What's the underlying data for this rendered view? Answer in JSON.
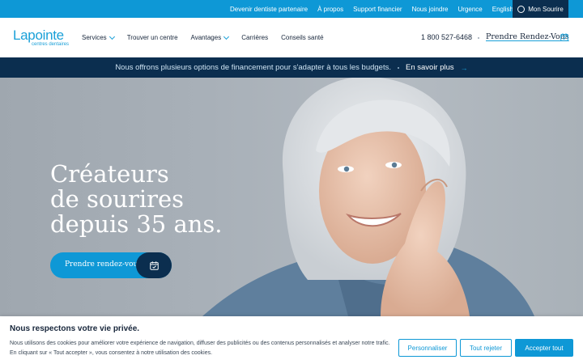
{
  "topbar": {
    "links": [
      "Devenir dentiste partenaire",
      "À propos",
      "Support financier",
      "Nous joindre",
      "Urgence",
      "English"
    ],
    "account_label": "Mon Sourire"
  },
  "header": {
    "logo": {
      "word": "Lapointe",
      "subtitle": "centres dentaires"
    },
    "nav": [
      {
        "label": "Services",
        "dropdown": true
      },
      {
        "label": "Trouver un centre",
        "dropdown": false
      },
      {
        "label": "Avantages",
        "dropdown": true
      },
      {
        "label": "Carrières",
        "dropdown": false
      },
      {
        "label": "Conseils santé",
        "dropdown": false
      }
    ],
    "phone": "1 800 527-6468",
    "appointment": "Prendre Rendez-Vous"
  },
  "promo": {
    "text": "Nous offrons plusieurs options de financement pour s'adapter à tous les budgets.",
    "link": "En savoir plus"
  },
  "hero": {
    "headline": [
      "Créateurs",
      "de sourires",
      "depuis 35 ans."
    ],
    "cta": "Prendre rendez-vous"
  },
  "cookie": {
    "title": "Nous respectons votre vie privée.",
    "text": "Nous utilisons des cookies pour améliorer votre expérience de navigation, diffuser des publicités ou des contenus personnalisés et analyser notre trafic. En cliquant sur « Tout accepter », vous consentez à notre utilisation des cookies.",
    "buttons": {
      "customize": "Personnaliser",
      "reject": "Tout rejeter",
      "accept": "Accepter tout"
    }
  },
  "colors": {
    "brand_blue": "#0e98d6",
    "navy": "#0b2e4f",
    "text": "#17263b"
  },
  "icons": [
    "user-ring-icon",
    "chevron-down-icon",
    "calendar-icon",
    "arrow-right-icon"
  ]
}
